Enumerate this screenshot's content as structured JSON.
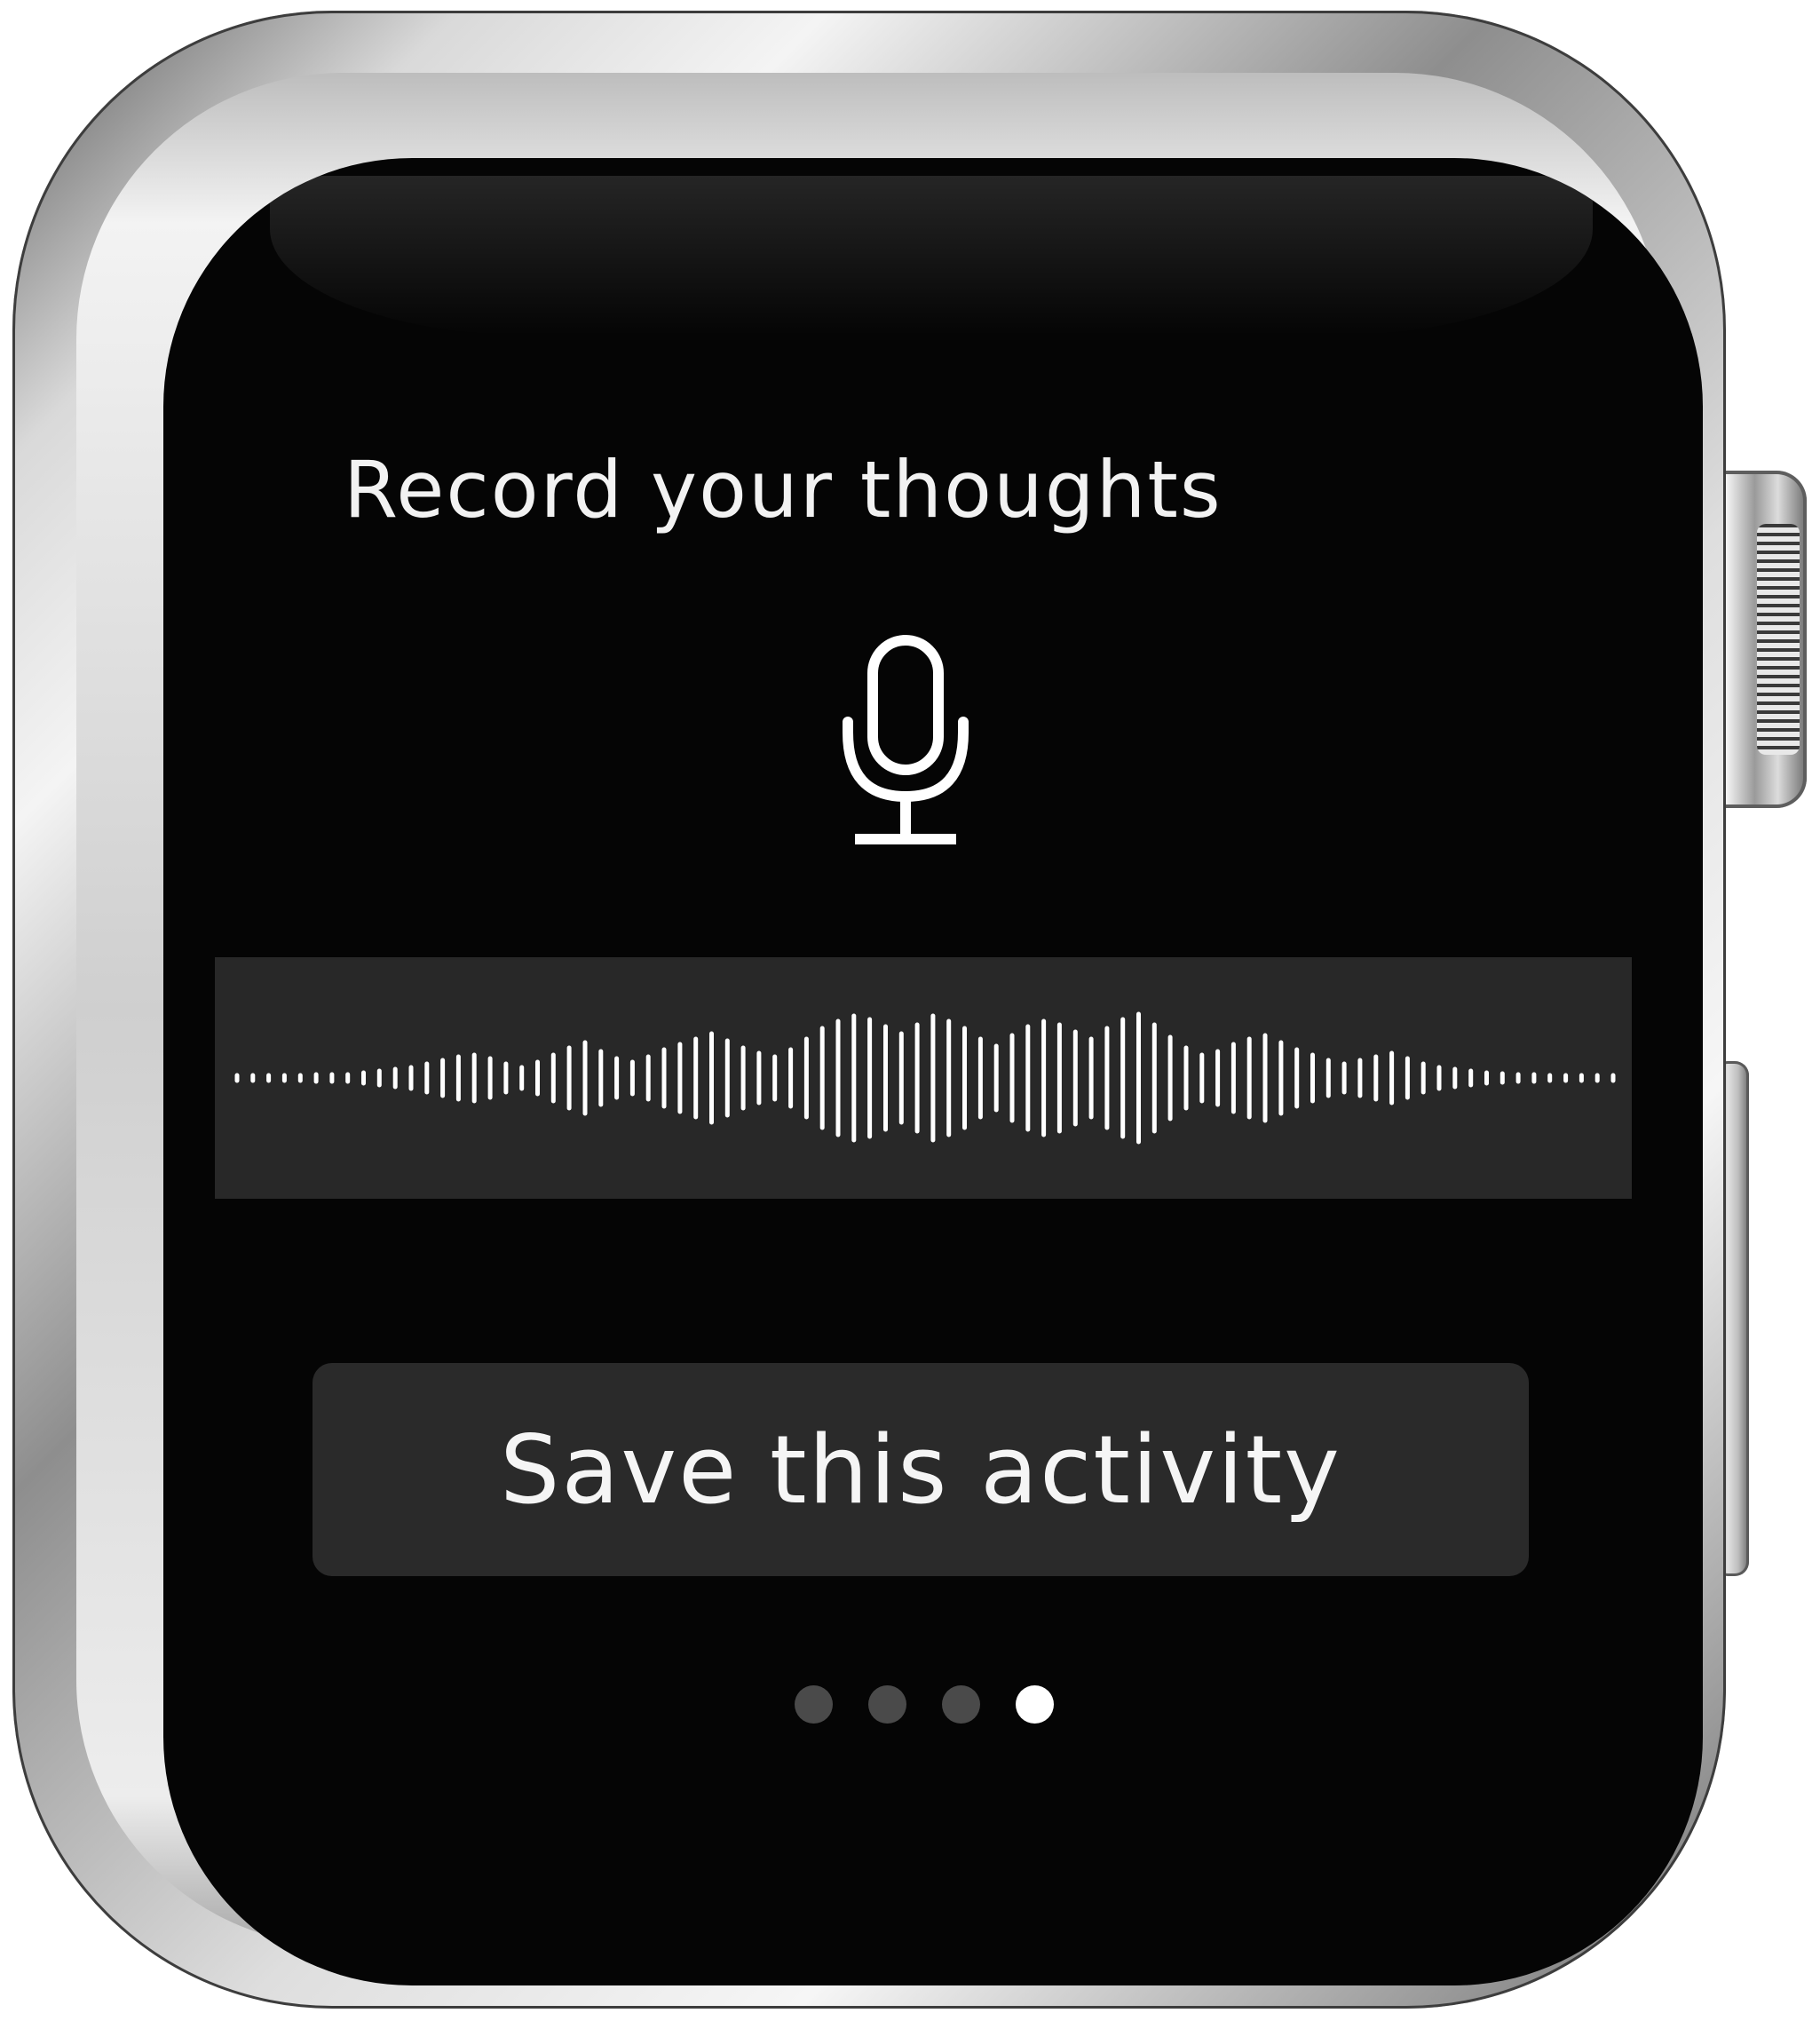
{
  "screen": {
    "title": "Record your thoughts",
    "mic_icon": "microphone-icon",
    "waveform_icon": "audio-waveform",
    "save_button_label": "Save this activity",
    "pager": {
      "total": 4,
      "current": 4
    }
  },
  "colors": {
    "background": "#050505",
    "band": "#282828",
    "button": "#2a2a2a",
    "text": "#f2f2f2",
    "dot_inactive": "#4a4a4a",
    "dot_active": "#ffffff"
  }
}
